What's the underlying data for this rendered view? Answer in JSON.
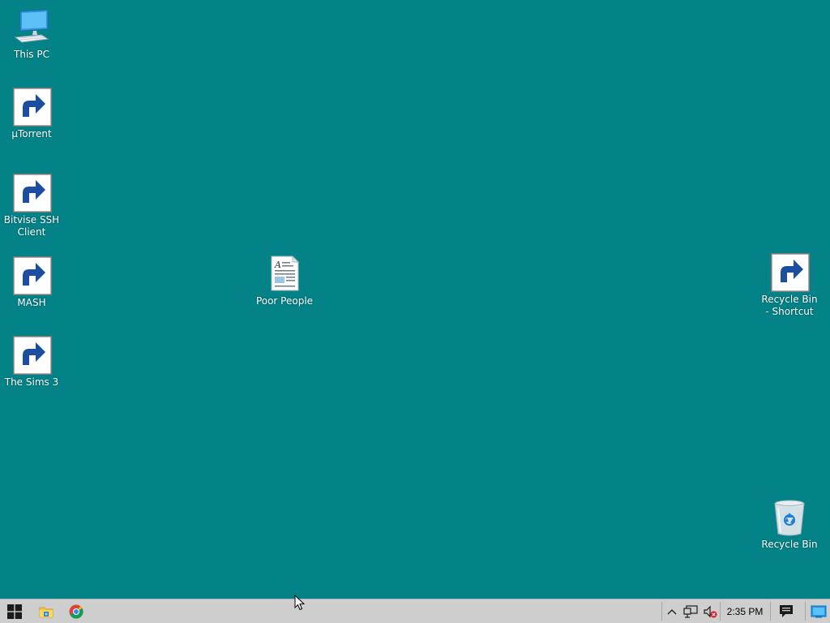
{
  "desktop": {
    "background_color": "#038387",
    "icons": {
      "this_pc": {
        "label": "This PC",
        "icon": "computer-icon"
      },
      "utorrent": {
        "label": "µTorrent",
        "icon": "utorrent-icon",
        "shortcut": true
      },
      "bitvise": {
        "label": "Bitvise SSH Client",
        "icon": "bitvise-cloud-icon",
        "shortcut": true
      },
      "mash": {
        "label": "MASH",
        "icon": "mash-hat-icon",
        "shortcut": true
      },
      "sims3": {
        "label": "The Sims 3",
        "icon": "blank-file-icon",
        "shortcut": true
      },
      "poor_people": {
        "label": "Poor People",
        "icon": "document-icon"
      },
      "recycle_shortcut": {
        "label": "Recycle Bin - Shortcut",
        "icon": "recycle-bin-icon",
        "shortcut": true
      },
      "recycle_bin": {
        "label": "Recycle Bin",
        "icon": "recycle-bin-icon"
      }
    }
  },
  "taskbar": {
    "background_color": "#cecece",
    "pinned": [
      "start-icon",
      "file-explorer-icon",
      "chrome-icon"
    ],
    "tray": {
      "icons": [
        "chevron-up-icon",
        "network-icon",
        "volume-muted-icon"
      ],
      "clock": "2:35 PM",
      "action_center_icon": "action-center-icon",
      "show_desktop_icon": "show-desktop-icon"
    }
  }
}
